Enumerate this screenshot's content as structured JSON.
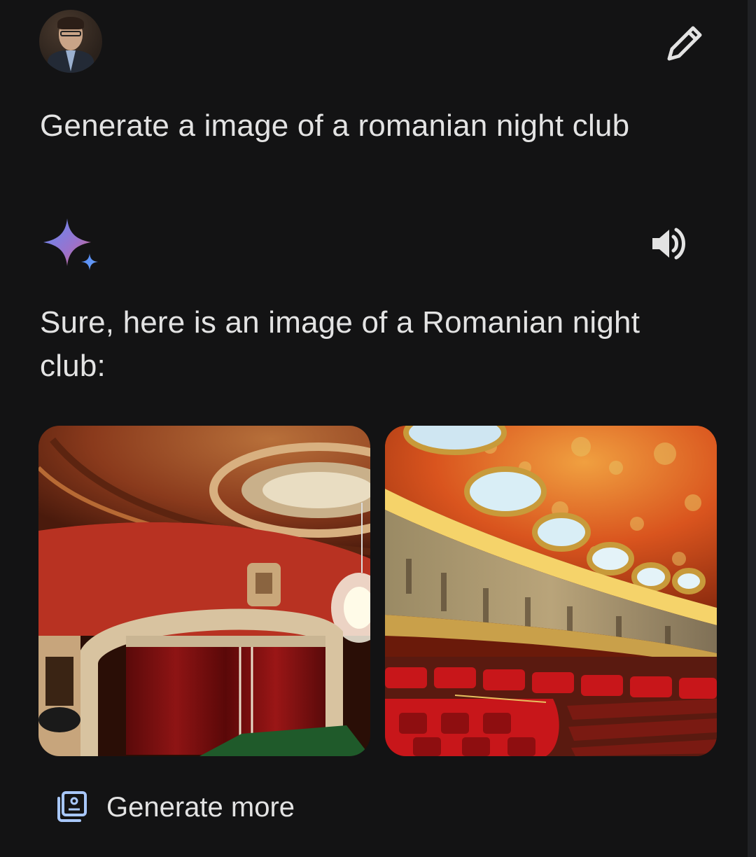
{
  "user": {
    "avatar_icon": "user-avatar"
  },
  "prompt": {
    "text": "Generate a image of a romanian night club"
  },
  "actions": {
    "edit_icon": "pencil-icon",
    "speak_icon": "speaker-icon"
  },
  "response": {
    "icon": "gemini-sparkle-icon",
    "text": "Sure, here is an image of a Romanian night club:"
  },
  "images": [
    {
      "subject": "theatre-stage-red-curtain"
    },
    {
      "subject": "ornate-domed-concert-hall"
    }
  ],
  "generate_more": {
    "label": "Generate more",
    "icon": "image-stack-icon"
  },
  "colors": {
    "background": "#131314",
    "text": "#e3e3e3",
    "sparkle_start": "#5f8cf7",
    "sparkle_end": "#c27cd8",
    "icon_accent": "#a8c7fa"
  }
}
